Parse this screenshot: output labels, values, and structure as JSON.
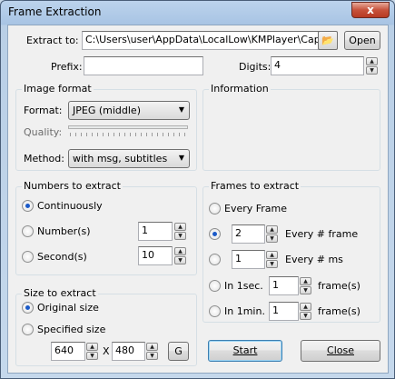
{
  "window": {
    "title": "Frame Extraction",
    "close_glyph": "x"
  },
  "extract_to": {
    "label": "Extract to:",
    "path": "C:\\Users\\user\\AppData\\LocalLow\\KMPlayer\\Cap",
    "open_label": "Open",
    "folder_icon": "folder-icon"
  },
  "prefix": {
    "label": "Prefix:",
    "value": ""
  },
  "digits": {
    "label": "Digits:",
    "value": "4"
  },
  "image_format": {
    "title": "Image format",
    "format_label": "Format:",
    "format_value": "JPEG (middle)",
    "quality_label": "Quality:",
    "method_label": "Method:",
    "method_value": "with msg, subtitles"
  },
  "information": {
    "title": "Information"
  },
  "numbers_to_extract": {
    "title": "Numbers to extract",
    "continuously": "Continuously",
    "numbers": "Number(s)",
    "numbers_value": "1",
    "seconds": "Second(s)",
    "seconds_value": "10",
    "selected": "continuously"
  },
  "size_to_extract": {
    "title": "Size to extract",
    "original": "Original size",
    "specified": "Specified size",
    "width": "640",
    "x_label": "X",
    "height": "480",
    "g_label": "G",
    "selected": "original"
  },
  "frames_to_extract": {
    "title": "Frames to extract",
    "every_frame": "Every Frame",
    "every_n_frame_value": "2",
    "every_n_frame_label": "Every # frame",
    "every_n_ms_value": "1",
    "every_n_ms_label": "Every # ms",
    "in_1sec_label": "In 1sec.",
    "in_1sec_value": "1",
    "in_1sec_unit": "frame(s)",
    "in_1min_label": "In 1min.",
    "in_1min_value": "1",
    "in_1min_unit": "frame(s)",
    "selected": "every_n_frame"
  },
  "buttons": {
    "start": "Start",
    "close": "Close"
  }
}
